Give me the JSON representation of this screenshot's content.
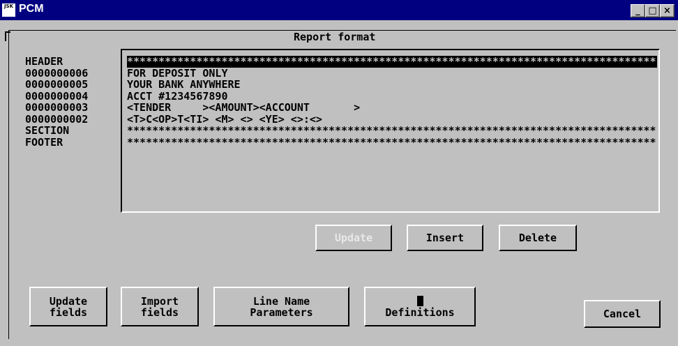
{
  "window": {
    "title": "PCM",
    "icon_text": "JSK"
  },
  "controls": {
    "minimize": "_",
    "maximize": "□",
    "close": "×"
  },
  "group_title": "Report format",
  "line_labels": [
    "HEADER",
    "0000000006",
    "0000000005",
    "0000000004",
    "0000000003",
    "0000000002",
    "SECTION",
    "FOOTER"
  ],
  "report_lines": [
    "************************************************************************************",
    "FOR DEPOSIT ONLY",
    "YOUR BANK ANYWHERE",
    "ACCT #1234567890",
    "<TENDER     ><AMOUNT><ACCOUNT       >",
    "<T>C<OP>T<TI> <M> <> <YE> <>:<>",
    "************************************************************************************",
    "************************************************************************************"
  ],
  "buttons": {
    "update": "Update",
    "insert": "Insert",
    "delete": "Delete",
    "update_fields_1": "Update",
    "update_fields_2": "fields",
    "import_fields_1": "Import",
    "import_fields_2": "fields",
    "line_name_1": "Line Name",
    "line_name_2": "Parameters",
    "definitions": "Definitions",
    "cancel": "Cancel"
  }
}
